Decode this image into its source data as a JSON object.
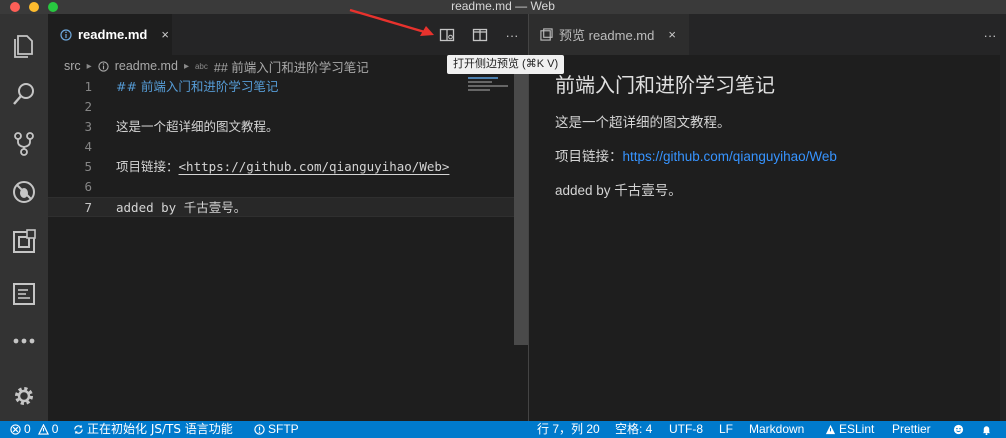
{
  "window": {
    "title": "readme.md — Web"
  },
  "activity_bar": {
    "items": [
      "explorer-icon",
      "search-icon",
      "source-control-icon",
      "debug-icon",
      "extensions-icon",
      "panel-icon",
      "more-icon",
      "settings-icon"
    ]
  },
  "left_editor": {
    "tab": {
      "label": "readme.md",
      "close": "×"
    },
    "toolbar": {
      "more": "···"
    },
    "breadcrumb": {
      "folder": "src",
      "file": "readme.md",
      "symbol_prefix": "abc",
      "symbol": "## 前端入门和进阶学习笔记"
    },
    "lines": [
      {
        "num": "1",
        "text": "## 前端入门和进阶学习笔记"
      },
      {
        "num": "2",
        "text": ""
      },
      {
        "num": "3",
        "text": "这是一个超详细的图文教程。"
      },
      {
        "num": "4",
        "text": ""
      },
      {
        "num": "5",
        "text_prefix": "项目链接：",
        "text_link": "<https://github.com/qianguyihao/Web>"
      },
      {
        "num": "6",
        "text": ""
      },
      {
        "num": "7",
        "text": "added by 千古壹号。"
      }
    ]
  },
  "tooltip": {
    "text": "打开侧边预览 (⌘K V)"
  },
  "right_editor": {
    "tab": {
      "label": "预览 readme.md",
      "close": "×"
    },
    "toolbar": {
      "more": "···"
    },
    "preview": {
      "heading": "前端入门和进阶学习笔记",
      "p1": "这是一个超详细的图文教程。",
      "p2_prefix": "项目链接：",
      "p2_link": "https://github.com/qianguyihao/Web",
      "p3": "added by 千古壹号。"
    }
  },
  "status_bar": {
    "errors": "0",
    "warnings": "0",
    "init_js": "正在初始化 JS/TS 语言功能",
    "sftp": "SFTP",
    "position": "行 7，列 20",
    "spaces": "空格: 4",
    "encoding": "UTF-8",
    "eol": "LF",
    "language": "Markdown",
    "eslint": "ESLint",
    "prettier": "Prettier"
  },
  "colors": {
    "accent": "#007acc",
    "heading": "#569cd6",
    "link": "#3794ff",
    "annotation_arrow": "#e8322d"
  }
}
